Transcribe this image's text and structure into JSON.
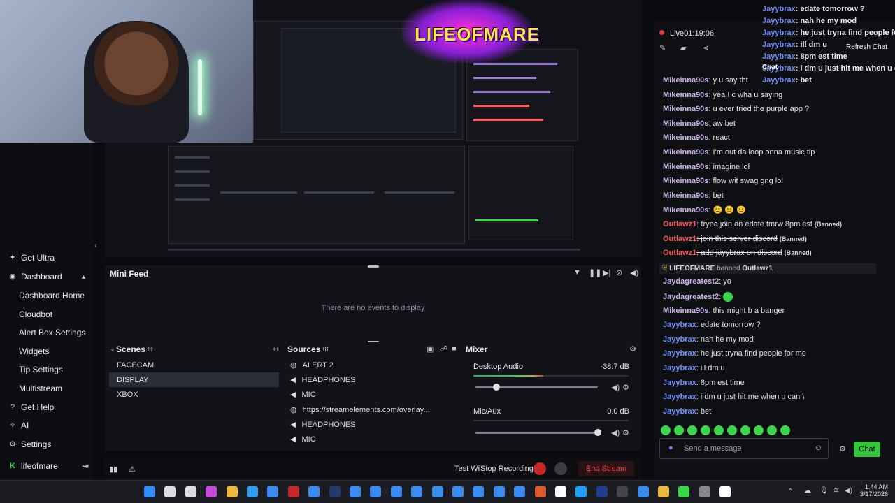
{
  "overlay_chat": [
    {
      "user": "Jayybrax",
      "text": ": edate tomorrow ?"
    },
    {
      "user": "Jayybrax",
      "text": ": nah he my mod"
    },
    {
      "user": "Jayybrax",
      "text": ": he just tryna find people for me"
    },
    {
      "user": "Jayybrax",
      "text": ": ill dm u"
    },
    {
      "user": "Jayybrax",
      "text": ": 8pm est time"
    },
    {
      "user": "Jayybrax",
      "text": ": i dm u just hit me when u can \\"
    },
    {
      "user": "Jayybrax",
      "text": ": bet"
    }
  ],
  "overlay_labels": {
    "refresh": "Refresh Chat",
    "chat": "Chat"
  },
  "stream": {
    "live_label": "Live",
    "time": "01:19:06"
  },
  "sidebar": {
    "items": [
      {
        "label": "Get Ultra"
      },
      {
        "label": "Dashboard"
      },
      {
        "label": "Dashboard Home"
      },
      {
        "label": "Cloudbot"
      },
      {
        "label": "Alert Box Settings"
      },
      {
        "label": "Widgets"
      },
      {
        "label": "Tip Settings"
      },
      {
        "label": "Multistream"
      },
      {
        "label": "Get Help"
      },
      {
        "label": "AI"
      },
      {
        "label": "Settings"
      },
      {
        "label": "lifeofmare"
      }
    ]
  },
  "logo_text": "LIFEOFMARE",
  "minifeed": {
    "title": "Mini Feed",
    "empty": "There are no events to display"
  },
  "scenes": {
    "title": "Scenes",
    "items": [
      "FACECAM",
      "DISPLAY",
      "XBOX"
    ],
    "selected": "DISPLAY"
  },
  "sources": {
    "title": "Sources",
    "items": [
      "ALERT 2",
      "HEADPHONES",
      "MIC",
      "https://streamelements.com/overlay...",
      "HEADPHONES",
      "MIC"
    ]
  },
  "mixer": {
    "title": "Mixer",
    "channels": [
      {
        "name": "Desktop Audio",
        "db": "-38.7 dB",
        "level": 0.45,
        "volume": 0.17
      },
      {
        "name": "Mic/Aux",
        "db": "0.0 dB",
        "level": 0.0,
        "volume": 1.0
      }
    ]
  },
  "bottom": {
    "test": "Test Wi",
    "stop_recording": "Stop Recording",
    "end_stream": "End Stream"
  },
  "chat": {
    "messages": [
      {
        "user": "Mikeinna90s",
        "text": ": y u say tht",
        "type": "m"
      },
      {
        "user": "Mikeinna90s",
        "text": ": yea I c wha u saying",
        "type": "m"
      },
      {
        "user": "Mikeinna90s",
        "text": ": u ever tried the purple app ?",
        "type": "m"
      },
      {
        "user": "Mikeinna90s",
        "text": ": aw bet",
        "type": "m"
      },
      {
        "user": "Mikeinna90s",
        "text": ": react",
        "type": "m"
      },
      {
        "user": "Mikeinna90s",
        "text": ": I'm out da loop onna music tip",
        "type": "m"
      },
      {
        "user": "Mikeinna90s",
        "text": ": imagine lol",
        "type": "m"
      },
      {
        "user": "Mikeinna90s",
        "text": ": flow wit swag gng lol",
        "type": "m"
      },
      {
        "user": "Mikeinna90s",
        "text": ": bet",
        "type": "m"
      },
      {
        "user": "Mikeinna90s",
        "text": ": 😊 😊 😊",
        "type": "m"
      },
      {
        "user": "Outlawz1",
        "text": ": tryna join an edate tmrw 8pm est",
        "type": "o"
      },
      {
        "user": "Outlawz1",
        "text": ": join this server discord",
        "type": "o"
      },
      {
        "user": "Outlawz1",
        "text": ": add jayybrax on discord",
        "type": "o"
      },
      {
        "user": "",
        "text": "",
        "type": "ban"
      },
      {
        "user": "Jaydagreatest2",
        "text": ": yo",
        "type": "jd"
      },
      {
        "user": "Jaydagreatest2",
        "text": ":",
        "type": "jd"
      },
      {
        "user": "Mikeinna90s",
        "text": ": this might b a banger",
        "type": "m"
      },
      {
        "user": "Jayybrax",
        "text": ": edate tomorrow ?",
        "type": "j"
      },
      {
        "user": "Jayybrax",
        "text": ": nah he my mod",
        "type": "j"
      },
      {
        "user": "Jayybrax",
        "text": ": he just tryna find people for me",
        "type": "j"
      },
      {
        "user": "Jayybrax",
        "text": ": ill dm u",
        "type": "j"
      },
      {
        "user": "Jayybrax",
        "text": ": 8pm est time",
        "type": "j"
      },
      {
        "user": "Jayybrax",
        "text": ": i dm u just hit me when u can \\",
        "type": "j"
      },
      {
        "user": "Jayybrax",
        "text": ": bet",
        "type": "j"
      }
    ],
    "banned_tag": "(Banned)",
    "ban_notice": {
      "actor": "LIFEOFMARE",
      "verb": "banned",
      "target": "Outlawz1"
    },
    "placeholder": "Send a message",
    "send_label": "Chat"
  },
  "clock": {
    "time": "1:44 AM",
    "date": "3/17/2026"
  },
  "taskbar_icons": [
    "windows-icon",
    "search-icon",
    "task-view-icon",
    "copilot-icon",
    "explorer-icon",
    "edge-icon",
    "store-icon",
    "mcafee-icon",
    "app-icon",
    "steam-icon",
    "app-icon",
    "app-icon",
    "app-icon",
    "app-icon",
    "app-icon",
    "app-icon",
    "app-icon",
    "app-icon",
    "app-icon",
    "fl-studio-icon",
    "capcut-icon",
    "app-icon",
    "photoshop-icon",
    "app-icon",
    "app-icon",
    "chrome-icon",
    "streamelements-icon",
    "obs-icon",
    "capcut-icon"
  ],
  "colors": {
    "accent": "#34c53b",
    "live": "#e23b3b",
    "link": "#6f8fff"
  }
}
